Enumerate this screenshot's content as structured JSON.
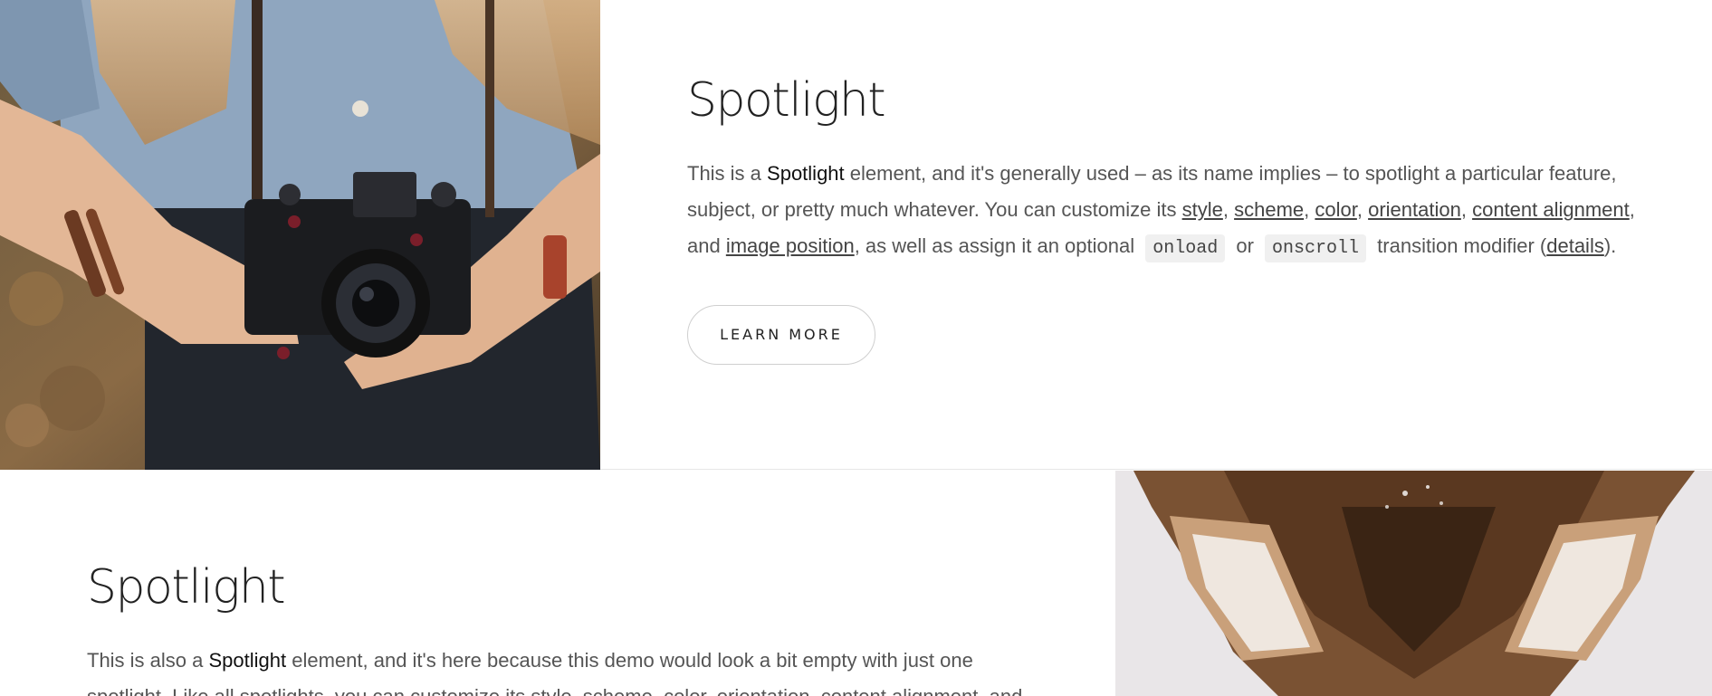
{
  "spotlight_1": {
    "heading": "Spotlight",
    "p_intro": "This is a ",
    "p_strong": "Spotlight",
    "p_part1": " element, and it's generally used – as its name implies – to spotlight a particular feature, subject, or pretty much whatever. You can customize its ",
    "link_style": "style",
    "sep1": ", ",
    "link_scheme": "scheme",
    "sep2": ", ",
    "link_color": "color",
    "sep3": ", ",
    "link_orientation": "orientation",
    "sep4": ", ",
    "link_content_alignment": "content alignment",
    "sep5": ", and ",
    "link_image_position": "image position",
    "p_part2": ", as well as assign it an optional ",
    "code_onload": "onload",
    "or": " or ",
    "code_onscroll": "onscroll",
    "p_part3": " transition modifier (",
    "link_details": "details",
    "p_end": ").",
    "button_label": "LEARN MORE"
  },
  "spotlight_2": {
    "heading": "Spotlight",
    "p_intro": "This is also a ",
    "p_strong": "Spotlight",
    "p_part1": " element, and it's here because this demo would look a bit empty with just one spotlight. Like all spotlights, you can customize its style, scheme, color, orientation, content alignment, and"
  },
  "images": {
    "image_1": "woman-holding-camera-photo",
    "image_2": "fox-head-photo"
  }
}
